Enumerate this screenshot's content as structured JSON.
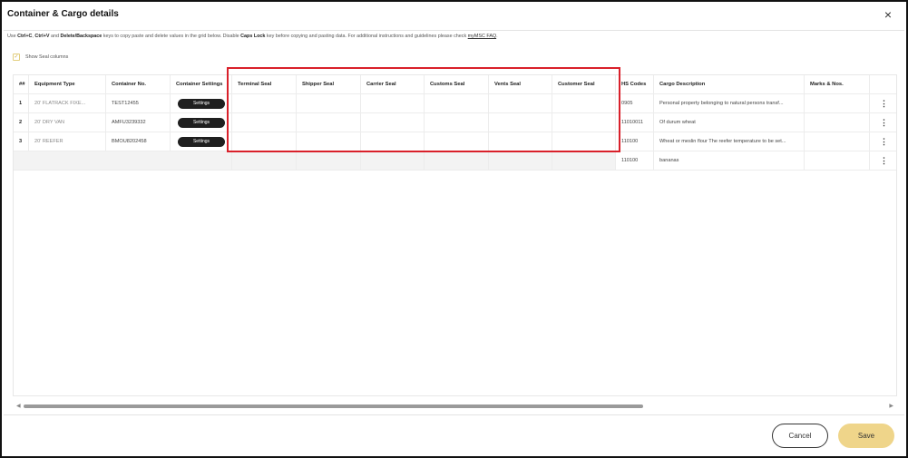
{
  "dialog": {
    "title": "Container & Cargo details",
    "close_icon": "×"
  },
  "info": {
    "pre": "Use ",
    "k1": "Ctrl+C",
    "s1": ", ",
    "k2": "Ctrl+V",
    "s2": " and ",
    "k3": "Delete/Backspace",
    "s3": " keys to copy paste and delete values in the grid below. Disable ",
    "k4": "Caps Lock",
    "s4": " key before copying and pasting data. For additional instructions and guidelines please check ",
    "link": "myMSC FAQ",
    "end": "."
  },
  "seal_toggle": {
    "label": "Show Seal columns",
    "checked": true
  },
  "grid": {
    "headers": {
      "num": "##",
      "equipment": "Equipment Type",
      "container_no": "Container No.",
      "settings": "Container Settings",
      "terminal": "Terminal Seal",
      "shipper": "Shipper Seal",
      "carrier": "Carrier Seal",
      "customs": "Customs Seal",
      "vents": "Vents Seal",
      "customer": "Customer Seal",
      "hs": "HS Codes",
      "cargo": "Cargo Description",
      "marks": "Marks & Nos."
    },
    "settings_label": "Settings",
    "rows": [
      {
        "num": "1",
        "equipment": "20' FLATRACK FIXE...",
        "container_no": "TEST12455",
        "hs": "0905",
        "cargo": "Personal property belonging to natural persons transf..."
      },
      {
        "num": "2",
        "equipment": "20' DRY VAN",
        "container_no": "AMFU3239332",
        "hs": "11010011",
        "cargo": "Of durum wheat"
      },
      {
        "num": "3",
        "equipment": "20' REEFER",
        "container_no": "BMOU8202458",
        "hs": "110100",
        "cargo": "Wheat or meslin flour The reefer temperature to be set..."
      },
      {
        "num": "",
        "equipment": "",
        "container_no": "",
        "hs": "110100",
        "cargo": "bananas"
      }
    ],
    "kebab": "⋮"
  },
  "scrollbar": {
    "left": "◀",
    "right": "▶"
  },
  "footer": {
    "cancel": "Cancel",
    "save": "Save"
  }
}
